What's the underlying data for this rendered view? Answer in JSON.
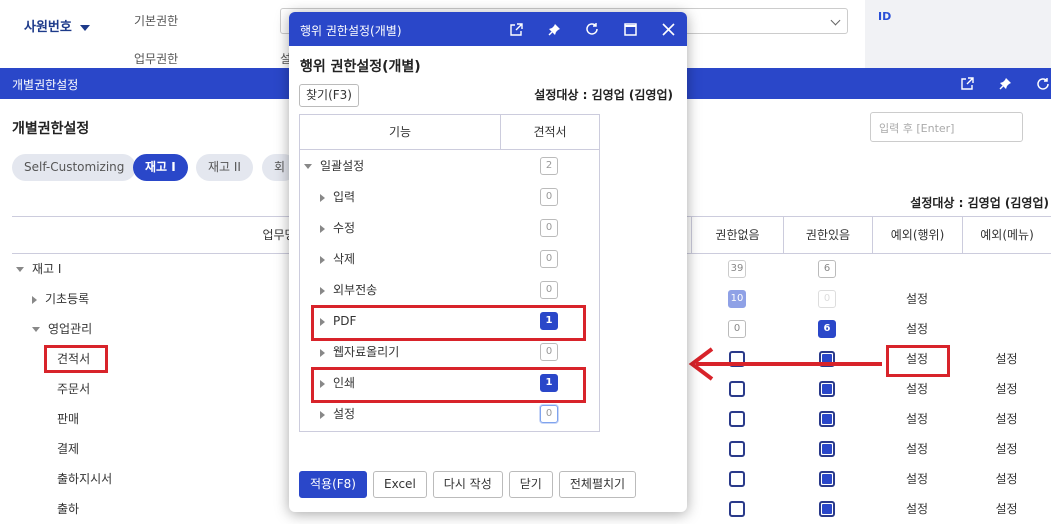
{
  "background": {
    "employee_label": "사원번호",
    "field1_label": "기본권한",
    "field2_label": "업무권한",
    "field2_value": "설",
    "id_label": "ID"
  },
  "main": {
    "window_title": "개별권한설정",
    "heading": "개별권한설정",
    "search_placeholder": "입력 후 [Enter]",
    "tabs": [
      "Self-Customizing",
      "재고 I",
      "재고 II",
      "회"
    ],
    "active_tab": "재고 I",
    "target_label": "설정대상 : 김영업 (김영업)",
    "columns": [
      "업무명",
      "권한없음",
      "권한있음",
      "예외(행위)",
      "예외(메뉴)"
    ],
    "rows": [
      {
        "name": "재고 I",
        "level": 0,
        "tree": "open",
        "none": "39",
        "has": "6",
        "act": "",
        "menu": ""
      },
      {
        "name": "기초등록",
        "level": 1,
        "tree": "closed",
        "none": "10",
        "has": "0",
        "act": "설정",
        "menu": ""
      },
      {
        "name": "영업관리",
        "level": 1,
        "tree": "open",
        "none": "0",
        "has": "6",
        "act": "설정",
        "menu": ""
      },
      {
        "name": "견적서",
        "level": 2,
        "tree": "",
        "none": "",
        "has": "",
        "act": "설정",
        "menu": "설정"
      },
      {
        "name": "주문서",
        "level": 2,
        "tree": "",
        "none": "",
        "has": "",
        "act": "설정",
        "menu": "설정"
      },
      {
        "name": "판매",
        "level": 2,
        "tree": "",
        "none": "",
        "has": "",
        "act": "설정",
        "menu": "설정"
      },
      {
        "name": "결제",
        "level": 2,
        "tree": "",
        "none": "",
        "has": "",
        "act": "설정",
        "menu": "설정"
      },
      {
        "name": "출하지시서",
        "level": 2,
        "tree": "",
        "none": "",
        "has": "",
        "act": "설정",
        "menu": "설정"
      },
      {
        "name": "출하",
        "level": 2,
        "tree": "",
        "none": "",
        "has": "",
        "act": "설정",
        "menu": "설정"
      }
    ]
  },
  "popup": {
    "window_title": "행위 권한설정(개별)",
    "heading": "행위 권한설정(개별)",
    "find_button": "찾기(F3)",
    "target_label": "설정대상 : 김영업 (김영업)",
    "columns": [
      "기능",
      "견적서"
    ],
    "rows": [
      {
        "name": "일괄설정",
        "level": 0,
        "tree": "open",
        "value": "2"
      },
      {
        "name": "입력",
        "level": 1,
        "tree": "closed",
        "value": "0"
      },
      {
        "name": "수정",
        "level": 1,
        "tree": "closed",
        "value": "0"
      },
      {
        "name": "삭제",
        "level": 1,
        "tree": "closed",
        "value": "0"
      },
      {
        "name": "외부전송",
        "level": 1,
        "tree": "closed",
        "value": "0"
      },
      {
        "name": "PDF",
        "level": 1,
        "tree": "closed",
        "value": "1"
      },
      {
        "name": "웹자료올리기",
        "level": 1,
        "tree": "closed",
        "value": "0"
      },
      {
        "name": "인쇄",
        "level": 1,
        "tree": "closed",
        "value": "1"
      },
      {
        "name": "설정",
        "level": 1,
        "tree": "closed",
        "value": "0"
      }
    ],
    "buttons": [
      "적용(F8)",
      "Excel",
      "다시 작성",
      "닫기",
      "전체펼치기"
    ]
  },
  "colors": {
    "accent": "#2a47c9",
    "highlight": "#d8232a"
  }
}
